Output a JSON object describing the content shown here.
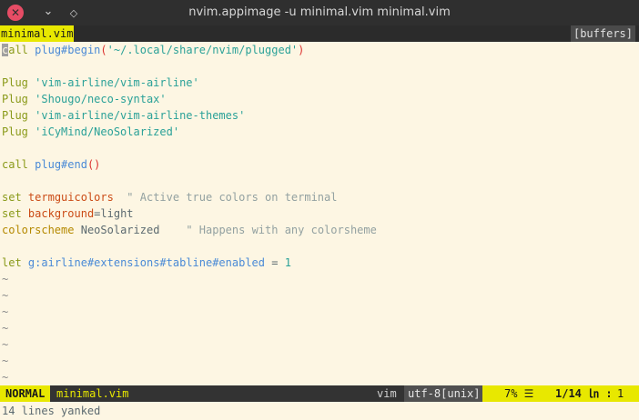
{
  "window": {
    "title": "nvim.appimage -u minimal.vim minimal.vim",
    "close_glyph": "✕",
    "min_glyph": "⌄",
    "max_glyph": "◇"
  },
  "tabline": {
    "active": "minimal.vim",
    "buffers": "[buffers]"
  },
  "code": {
    "l1": {
      "kw": "call",
      "fn": "plug#begin",
      "open": "(",
      "str": "'~/.local/share/nvim/plugged'",
      "close": ")"
    },
    "l3": {
      "kw": "Plug",
      "str": "'vim-airline/vim-airline'"
    },
    "l4": {
      "kw": "Plug",
      "str": "'Shougo/neco-syntax'"
    },
    "l5": {
      "kw": "Plug",
      "str": "'vim-airline/vim-airline-themes'"
    },
    "l6": {
      "kw": "Plug",
      "str": "'iCyMind/NeoSolarized'"
    },
    "l8": {
      "kw": "call",
      "fn": "plug#end",
      "parens": "()"
    },
    "l10": {
      "kw": "set",
      "opt": "termguicolors",
      "comment": "\" Active true colors on terminal"
    },
    "l11": {
      "kw": "set",
      "opt": "background",
      "rest": "=light"
    },
    "l12": {
      "kw": "colorscheme",
      "name": "NeoSolarized",
      "comment": "\" Happens with any colorsheme"
    },
    "l14": {
      "kw": "let",
      "var": "g:airline#extensions#tabline#enabled",
      "eq": " = ",
      "num": "1"
    }
  },
  "tilde": "~",
  "statusline": {
    "mode": "NORMAL",
    "filename": "minimal.vim",
    "filetype": "vim",
    "encoding": "utf-8[unix]",
    "percent": "7% ☰",
    "line": "1/14 ㏑ :",
    "col": "1"
  },
  "cmdline": "14 lines yanked"
}
